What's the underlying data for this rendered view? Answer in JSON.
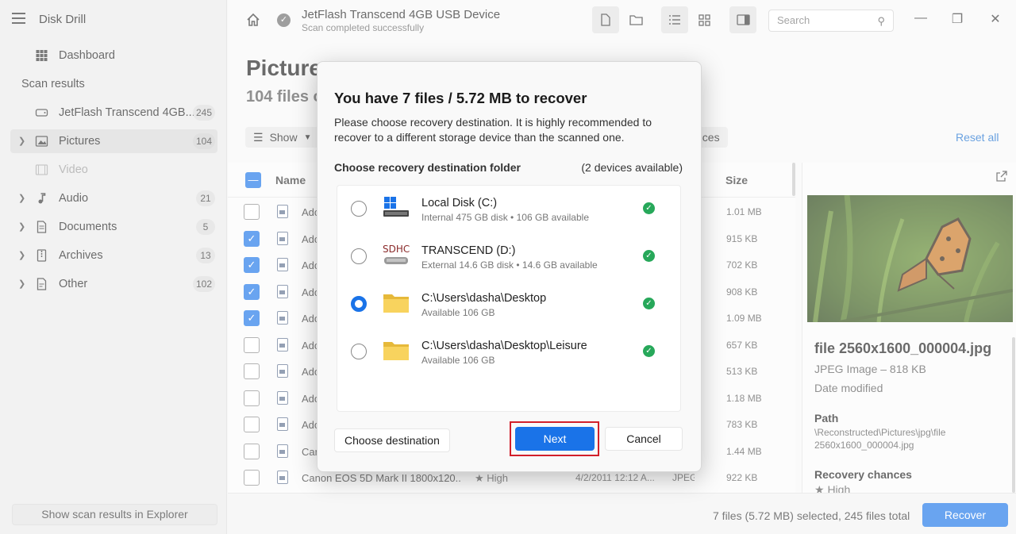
{
  "app": {
    "title": "Disk Drill"
  },
  "sidebar": {
    "dashboard_label": "Dashboard",
    "scan_results_title": "Scan results",
    "device": {
      "label": "JetFlash Transcend 4GB...",
      "count": "245"
    },
    "items": [
      {
        "label": "Pictures",
        "count": "104"
      },
      {
        "label": "Video",
        "count": ""
      },
      {
        "label": "Audio",
        "count": "21"
      },
      {
        "label": "Documents",
        "count": "5"
      },
      {
        "label": "Archives",
        "count": "13"
      },
      {
        "label": "Other",
        "count": "102"
      }
    ],
    "explorer_button": "Show scan results in Explorer"
  },
  "header": {
    "device_title": "JetFlash Transcend 4GB USB Device",
    "device_status": "Scan completed successfully",
    "search_placeholder": "Search"
  },
  "main": {
    "title": "Picture",
    "subtitle": "104 files o",
    "show_label": "Show",
    "chances_chip": "nces",
    "reset_all": "Reset all",
    "columns": {
      "name": "Name",
      "size": "Size"
    }
  },
  "rows": [
    {
      "name": "Ado",
      "chance": "",
      "date": "",
      "kind": "",
      "size": "1.01 MB",
      "checked": false
    },
    {
      "name": "Ado",
      "chance": "",
      "date": "",
      "kind": "",
      "size": "915 KB",
      "checked": true
    },
    {
      "name": "Ado",
      "chance": "",
      "date": "",
      "kind": "",
      "size": "702 KB",
      "checked": true
    },
    {
      "name": "Ado",
      "chance": "",
      "date": "",
      "kind": "",
      "size": "908 KB",
      "checked": true
    },
    {
      "name": "Ado",
      "chance": "",
      "date": "",
      "kind": "",
      "size": "1.09 MB",
      "checked": true
    },
    {
      "name": "Ado",
      "chance": "",
      "date": "",
      "kind": "",
      "size": "657 KB",
      "checked": false
    },
    {
      "name": "Ado",
      "chance": "",
      "date": "",
      "kind": "",
      "size": "513 KB",
      "checked": false
    },
    {
      "name": "Ado",
      "chance": "",
      "date": "",
      "kind": "",
      "size": "1.18 MB",
      "checked": false
    },
    {
      "name": "Ado",
      "chance": "",
      "date": "",
      "kind": "",
      "size": "783 KB",
      "checked": false
    },
    {
      "name": "Can",
      "chance": "",
      "date": "",
      "kind": "",
      "size": "1.44 MB",
      "checked": false
    },
    {
      "name": "Canon EOS 5D Mark II 1800x120...",
      "chance": "★ High",
      "date": "4/2/2011 12:12 A...",
      "kind": "JPEG Im...",
      "size": "922 KB",
      "checked": false
    }
  ],
  "preview": {
    "file_name": "file 2560x1600_000004.jpg",
    "file_type": "JPEG Image – 818 KB",
    "date_label": "Date modified",
    "path_label": "Path",
    "path_value": "\\Reconstructed\\Pictures\\jpg\\file 2560x1600_000004.jpg",
    "recovery_label": "Recovery chances",
    "recovery_value": "★ High"
  },
  "status": {
    "summary": "7 files (5.72 MB) selected, 245 files total",
    "recover_button": "Recover"
  },
  "dialog": {
    "title": "You have 7 files / 5.72 MB to recover",
    "description": "Please choose recovery destination. It is highly recommended to recover to a different storage device than the scanned one.",
    "folder_label": "Choose recovery destination folder",
    "devices_available": "(2 devices available)",
    "destinations": [
      {
        "name": "Local Disk (C:)",
        "detail": "Internal 475 GB disk • 106 GB available",
        "icon": "drive-icon",
        "selected": false
      },
      {
        "name": "TRANSCEND (D:)",
        "detail": "External 14.6 GB disk • 14.6 GB available",
        "icon": "sdhc-card-icon",
        "selected": false
      },
      {
        "name": "C:\\Users\\dasha\\Desktop",
        "detail": "Available 106 GB",
        "icon": "folder-icon",
        "selected": true
      },
      {
        "name": "C:\\Users\\dasha\\Desktop\\Leisure",
        "detail": "Available 106 GB",
        "icon": "folder-icon",
        "selected": false
      }
    ],
    "choose_destination": "Choose destination",
    "next": "Next",
    "cancel": "Cancel",
    "sdhc_text": "SDHC"
  },
  "colors": {
    "accent": "#1a73e8",
    "success": "#27a85a",
    "highlight_frame": "#d21f2a"
  }
}
